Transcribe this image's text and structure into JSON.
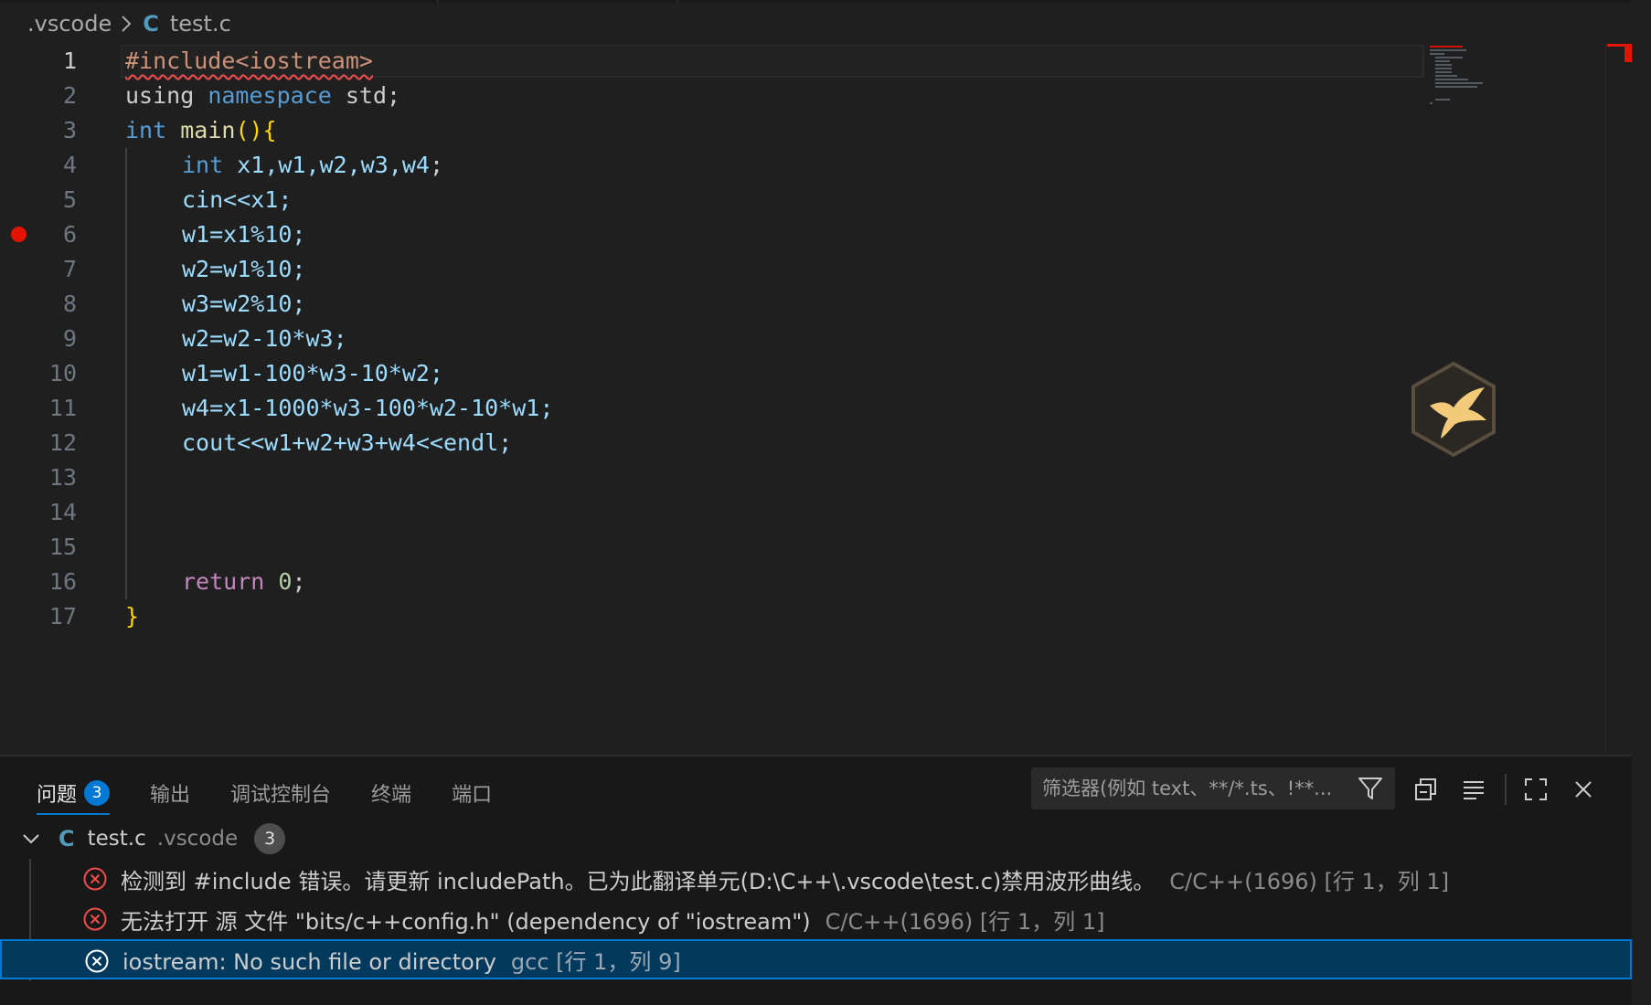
{
  "breadcrumb": {
    "folder": ".vscode",
    "file_icon": "C",
    "file": "test.c"
  },
  "editor": {
    "line_numbers": [
      "1",
      "2",
      "3",
      "4",
      "5",
      "6",
      "7",
      "8",
      "9",
      "10",
      "11",
      "12",
      "13",
      "14",
      "15",
      "16",
      "17"
    ],
    "lines": {
      "l1": {
        "include": "#include<iostream>"
      },
      "l2": {
        "kw1": "using",
        "kw2": "namespace",
        "ns": "std",
        "semi": ";"
      },
      "l3": {
        "type": "int",
        "fn": "main",
        "parens": "()",
        "brace": "{"
      },
      "l4": {
        "type": "int",
        "vars": "x1,w1,w2,w3,w4",
        "semi": ";"
      },
      "l5": {
        "text": "cin<<x1;"
      },
      "l6": {
        "text": "w1=x1%10;"
      },
      "l7": {
        "text": "w2=w1%10;"
      },
      "l8": {
        "text": "w3=w2%10;"
      },
      "l9": {
        "text": "w2=w2-10*w3;"
      },
      "l10": {
        "text": "w1=w1-100*w3-10*w2;"
      },
      "l11": {
        "text": "w4=x1-1000*w3-100*w2-10*w1;"
      },
      "l12": {
        "text": "cout<<w1+w2+w3+w4<<endl;"
      },
      "l16": {
        "kw": "return",
        "num": "0",
        "semi": ";"
      },
      "l17": {
        "brace": "}"
      }
    },
    "breakpoint_line": 6
  },
  "panel": {
    "tabs": [
      {
        "label": "问题",
        "badge": "3"
      },
      {
        "label": "输出"
      },
      {
        "label": "调试控制台"
      },
      {
        "label": "终端"
      },
      {
        "label": "端口"
      }
    ],
    "filter_placeholder": "筛选器(例如 text、**/*.ts、!**...",
    "file": {
      "icon": "C",
      "name": "test.c",
      "dir": ".vscode",
      "count": "3"
    },
    "problems": [
      {
        "message": "检测到 #include 错误。请更新 includePath。已为此翻译单元(D:\\C++\\.vscode\\test.c)禁用波形曲线。",
        "source": "C/C++(1696) [行 1，列 1]"
      },
      {
        "message": "无法打开 源 文件 \"bits/c++config.h\" (dependency of \"iostream\")",
        "source": "C/C++(1696) [行 1，列 1]"
      },
      {
        "message": "iostream: No such file or directory",
        "source": "gcc [行 1，列 9]"
      }
    ]
  },
  "colors": {
    "accent": "#0078d4",
    "error": "#f14c4c",
    "breakpoint": "#e51400"
  }
}
